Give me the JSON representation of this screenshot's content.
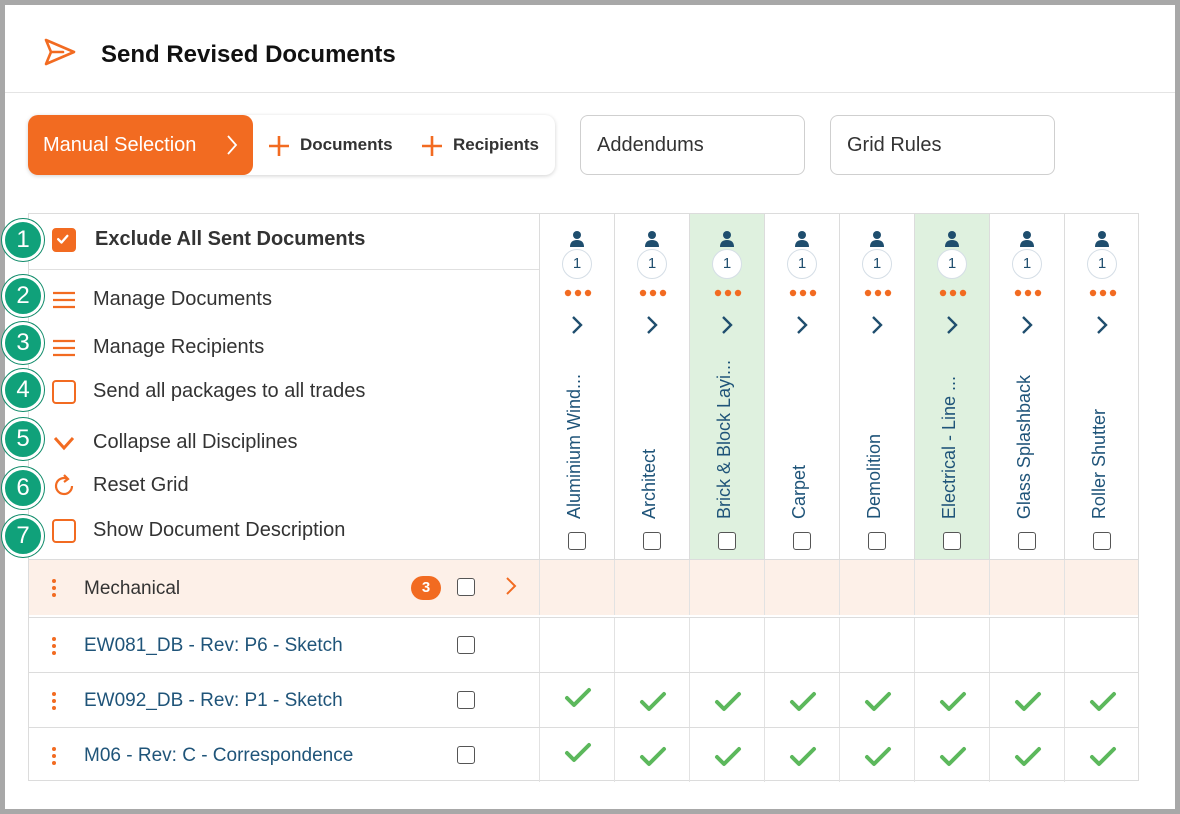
{
  "header": {
    "title": "Send Revised Documents"
  },
  "toolbar": {
    "active": "Manual Selection",
    "documents": "Documents",
    "recipients": "Recipients",
    "addendums": "Addendums",
    "grid_rules": "Grid Rules"
  },
  "options": {
    "exclude": "Exclude All Sent Documents",
    "manage_documents": "Manage Documents",
    "manage_recipients": "Manage Recipients",
    "send_all": "Send all packages to all trades",
    "collapse": "Collapse all Disciplines",
    "reset": "Reset Grid",
    "show_desc": "Show Document Description"
  },
  "badges": [
    "1",
    "2",
    "3",
    "4",
    "5",
    "6",
    "7"
  ],
  "trades": [
    {
      "name": "Aluminium Wind...",
      "count": "1"
    },
    {
      "name": "Architect",
      "count": "1"
    },
    {
      "name": "Brick & Block Layi...",
      "count": "1"
    },
    {
      "name": "Carpet",
      "count": "1"
    },
    {
      "name": "Demolition",
      "count": "1"
    },
    {
      "name": "Electrical - Line ...",
      "count": "1"
    },
    {
      "name": "Glass Splashback",
      "count": "1"
    },
    {
      "name": "Roller Shutter",
      "count": "1"
    }
  ],
  "group": {
    "name": "Mechanical",
    "count": "3"
  },
  "documents": [
    {
      "name": "EW081_DB - Rev: P6 - Sketch"
    },
    {
      "name": "EW092_DB - Rev: P1 - Sketch"
    },
    {
      "name": "M06 - Rev: C - Correspondence"
    }
  ],
  "colors": {
    "accent": "#f26b21",
    "badge": "#10a17a",
    "check": "#5cb85c",
    "highlight": "#dff1df",
    "link": "#1f5479"
  }
}
